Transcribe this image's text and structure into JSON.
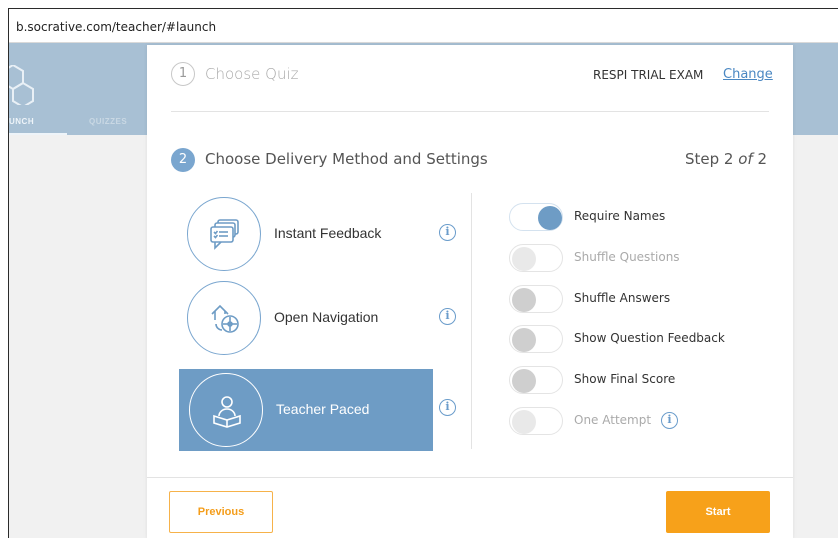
{
  "browser": {
    "url": "b.socrative.com/teacher/#launch"
  },
  "app": {
    "tabs": [
      {
        "label": "UNCH"
      },
      {
        "label": "QUIZZES"
      }
    ]
  },
  "step1": {
    "number": "1",
    "title": "Choose Quiz",
    "quiz_name": "RESPI TRIAL EXAM",
    "change_label": "Change"
  },
  "step2": {
    "number": "2",
    "title": "Choose Delivery Method and Settings",
    "progress_prefix": "Step 2 ",
    "progress_of": "of",
    "progress_total": " 2"
  },
  "delivery_methods": [
    {
      "label": "Instant Feedback",
      "icon": "chat-feedback-icon",
      "selected": false
    },
    {
      "label": "Open Navigation",
      "icon": "navigation-compass-icon",
      "selected": false
    },
    {
      "label": "Teacher Paced",
      "icon": "teacher-reading-icon",
      "selected": true
    }
  ],
  "settings": [
    {
      "label": "Require Names",
      "state": "on",
      "enabled": true
    },
    {
      "label": "Shuffle Questions",
      "state": "off",
      "enabled": false
    },
    {
      "label": "Shuffle Answers",
      "state": "off",
      "enabled": true
    },
    {
      "label": "Show Question Feedback",
      "state": "off",
      "enabled": true
    },
    {
      "label": "Show Final Score",
      "state": "off",
      "enabled": true
    },
    {
      "label": "One Attempt",
      "state": "off",
      "enabled": false
    }
  ],
  "footer": {
    "previous_label": "Previous",
    "start_label": "Start"
  },
  "colors": {
    "accent_blue": "#6e9cc5",
    "start_orange": "#f7a11a",
    "link_blue": "#4a87c2"
  }
}
